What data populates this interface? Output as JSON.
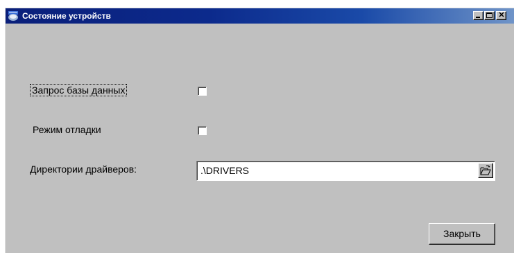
{
  "window": {
    "title": "Состояние устройств",
    "app_icon": "app-logo-icon",
    "controls": {
      "minimize_icon": "minimize-icon",
      "maximize_icon": "maximize-icon",
      "close_glyph": "✕"
    }
  },
  "form": {
    "db_query_label": "Запрос базы данных",
    "db_query_checked": false,
    "debug_mode_label": "Режим отладки",
    "debug_mode_checked": false,
    "drivers_dir_label": "Директории драйверов:",
    "drivers_dir_value": ".\\DRIVERS",
    "browse_icon": "folder-open-icon"
  },
  "footer": {
    "close_label": "Закрыть"
  },
  "colors": {
    "window_bg": "#c0c0c0",
    "titlebar_start": "#0a1f7a",
    "titlebar_end": "#6f94c8",
    "title_text": "#ffffff"
  }
}
